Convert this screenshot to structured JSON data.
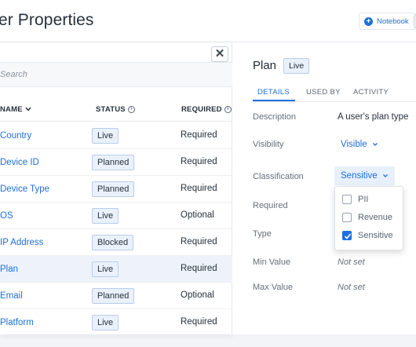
{
  "header": {
    "title": "er Properties",
    "notebook_label": "Notebook"
  },
  "list": {
    "close_label": "✕",
    "search_placeholder": "Search",
    "columns": {
      "name": "NAME",
      "status": "STATUS",
      "required": "REQUIRED"
    },
    "rows": [
      {
        "name": "Country",
        "status": "Live",
        "required": "Required"
      },
      {
        "name": "Device ID",
        "status": "Planned",
        "required": "Required"
      },
      {
        "name": "Device Type",
        "status": "Planned",
        "required": "Required"
      },
      {
        "name": "OS",
        "status": "Live",
        "required": "Optional"
      },
      {
        "name": "IP Address",
        "status": "Blocked",
        "required": "Required"
      },
      {
        "name": "Plan",
        "status": "Live",
        "required": "Required"
      },
      {
        "name": "Email",
        "status": "Planned",
        "required": "Optional"
      },
      {
        "name": "Platform",
        "status": "Live",
        "required": "Required"
      }
    ],
    "selected_row": "Plan"
  },
  "detail": {
    "title": "Plan",
    "status": "Live",
    "tabs": [
      "DETAILS",
      "USED BY",
      "ACTIVITY"
    ],
    "active_tab": "DETAILS",
    "fields": {
      "description_label": "Description",
      "description_value": "A user's plan type",
      "visibility_label": "Visibility",
      "visibility_value": "Visible",
      "classification_label": "Classification",
      "classification_value": "Sensitive",
      "required_label": "Required",
      "type_label": "Type",
      "min_label": "Min Value",
      "min_value": "Not set",
      "max_label": "Max Value",
      "max_value": "Not set"
    }
  },
  "classification_menu": {
    "options": [
      {
        "label": "PII",
        "checked": false
      },
      {
        "label": "Revenue",
        "checked": false
      },
      {
        "label": "Sensitive",
        "checked": true
      }
    ]
  },
  "colors": {
    "accent": "#1c6fde",
    "badge_bg": "#eaf1fb",
    "selected_row_bg": "#eef3fb"
  }
}
